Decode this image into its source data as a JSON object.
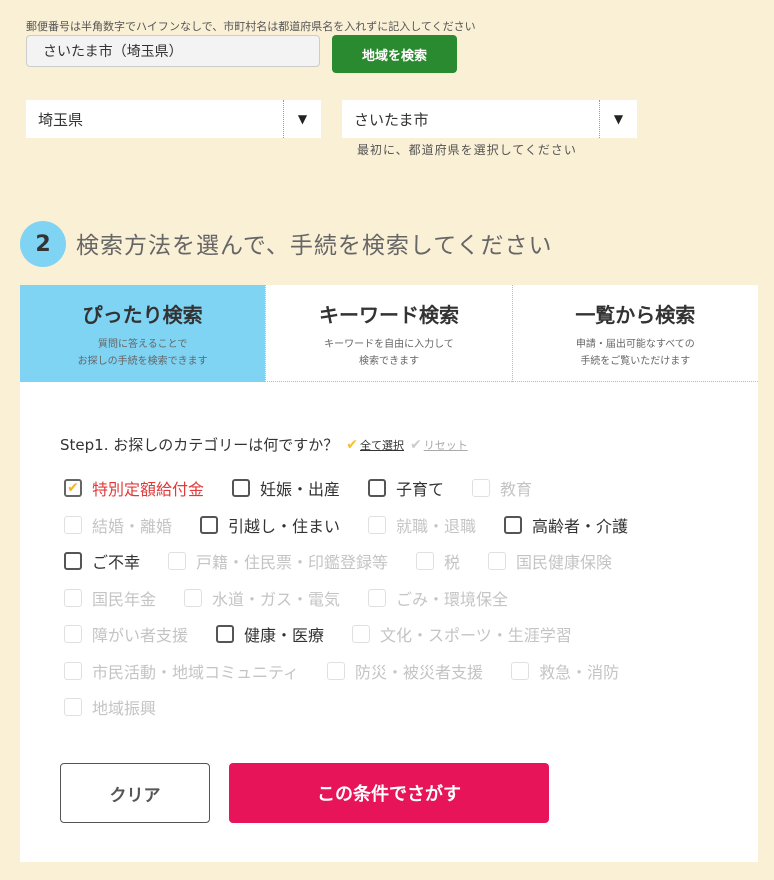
{
  "address": {
    "hint": "郵便番号は半角数字でハイフンなしで、市町村名は都道府県名を入れずに記入してください",
    "value": "さいたま市（埼玉県）",
    "search_button": "地域を検索"
  },
  "selects": {
    "prefecture": "埼玉県",
    "city": "さいたま市",
    "arrow": "▼",
    "hint": "最初に、都道府県を選択してください"
  },
  "step2": {
    "number": "2",
    "title": "検索方法を選んで、手続を検索してください"
  },
  "tabs": [
    {
      "title": "ぴったり検索",
      "sub1": "質問に答えることで",
      "sub2": "お探しの手続を検索できます"
    },
    {
      "title": "キーワード検索",
      "sub1": "キーワードを自由に入力して",
      "sub2": "検索できます"
    },
    {
      "title": "一覧から検索",
      "sub1": "申請・届出可能なすべての",
      "sub2": "手続をご覧いただけます"
    }
  ],
  "step1": {
    "label": "Step1. お探しのカテゴリーは何ですか？",
    "select_all": "全て選択",
    "reset": "リセット"
  },
  "categories": [
    {
      "label": "特別定額給付金",
      "state": "checked"
    },
    {
      "label": "妊娠・出産",
      "state": "on"
    },
    {
      "label": "子育て",
      "state": "on"
    },
    {
      "label": "教育",
      "state": "off"
    },
    {
      "label": "結婚・離婚",
      "state": "off"
    },
    {
      "label": "引越し・住まい",
      "state": "on"
    },
    {
      "label": "就職・退職",
      "state": "off"
    },
    {
      "label": "高齢者・介護",
      "state": "on"
    },
    {
      "label": "ご不幸",
      "state": "on"
    },
    {
      "label": "戸籍・住民票・印鑑登録等",
      "state": "off"
    },
    {
      "label": "税",
      "state": "off"
    },
    {
      "label": "国民健康保険",
      "state": "off"
    },
    {
      "label": "国民年金",
      "state": "off"
    },
    {
      "label": "水道・ガス・電気",
      "state": "off"
    },
    {
      "label": "ごみ・環境保全",
      "state": "off"
    },
    {
      "label": "障がい者支援",
      "state": "off"
    },
    {
      "label": "健康・医療",
      "state": "on"
    },
    {
      "label": "文化・スポーツ・生涯学習",
      "state": "off"
    },
    {
      "label": "市民活動・地域コミュニティ",
      "state": "off"
    },
    {
      "label": "防災・被災者支援",
      "state": "off"
    },
    {
      "label": "救急・消防",
      "state": "off"
    },
    {
      "label": "地域振興",
      "state": "off"
    }
  ],
  "buttons": {
    "clear": "クリア",
    "search": "この条件でさがす"
  },
  "colors": {
    "background": "#faf0d6",
    "accent_blue": "#7fd3f3",
    "search_green": "#2a8a2f",
    "primary_pink": "#e8145a",
    "checked_text": "#e03a3a"
  }
}
